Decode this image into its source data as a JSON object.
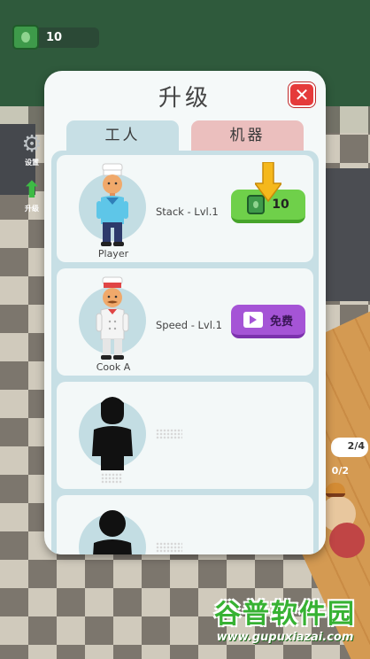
{
  "hud": {
    "money": "10",
    "settings_label": "设置",
    "upgrade_label": "升级"
  },
  "background": {
    "burger_badge": "2/4",
    "burger_count": "0/2"
  },
  "panel": {
    "title": "升级",
    "tabs": [
      {
        "label": "工人",
        "active": true
      },
      {
        "label": "机器",
        "active": false
      }
    ],
    "workers": [
      {
        "name": "Player",
        "stat": "Stack - Lvl.1",
        "action": "upgrade",
        "cost": "10",
        "locked": false
      },
      {
        "name": "Cook A",
        "stat": "Speed - Lvl.1",
        "action": "free",
        "action_label": "免费",
        "locked": false
      },
      {
        "name": "",
        "stat": "",
        "locked": true
      },
      {
        "name": "",
        "stat": "",
        "locked": true
      }
    ]
  },
  "watermark": {
    "title": "谷普软件园",
    "url": "www.gupuxiazai.com"
  },
  "colors": {
    "upgrade_button": "#6fd04a",
    "free_button": "#a554d6",
    "close_button": "#e53b3b",
    "tab_workers": "#c7dfe5",
    "tab_machines": "#ebbfbe"
  }
}
